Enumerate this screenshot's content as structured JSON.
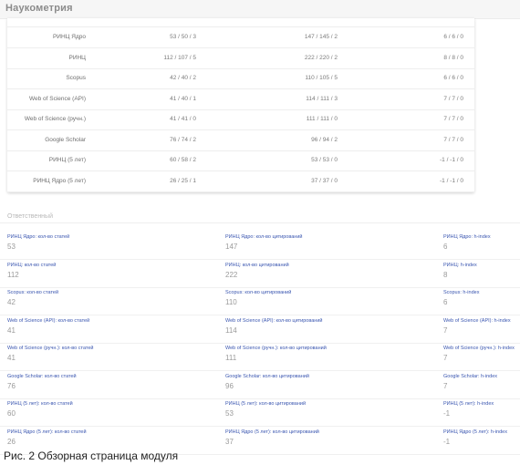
{
  "header": {
    "title": "Наукометрия"
  },
  "summary_table": {
    "rows": [
      {
        "metric": "РИНЦ Ядро",
        "articles": "53 / 50 / 3",
        "citations": "147 / 145 / 2",
        "hindex": "6 / 6 / 0"
      },
      {
        "metric": "РИНЦ",
        "articles": "112 / 107 / 5",
        "citations": "222 / 220 / 2",
        "hindex": "8 / 8 / 0"
      },
      {
        "metric": "Scopus",
        "articles": "42 / 40 / 2",
        "citations": "110 / 105 / 5",
        "hindex": "6 / 6 / 0"
      },
      {
        "metric": "Web of Science (API)",
        "articles": "41 / 40 / 1",
        "citations": "114 / 111 / 3",
        "hindex": "7 / 7 / 0"
      },
      {
        "metric": "Web of Science (ручн.)",
        "articles": "41 / 41 / 0",
        "citations": "111 / 111 / 0",
        "hindex": "7 / 7 / 0"
      },
      {
        "metric": "Google Scholar",
        "articles": "76 / 74 / 2",
        "citations": "96 / 94 / 2",
        "hindex": "7 / 7 / 0"
      },
      {
        "metric": "РИНЦ (5 лет)",
        "articles": "60 / 58 / 2",
        "citations": "53 / 53 / 0",
        "hindex": "-1 / -1 / 0"
      },
      {
        "metric": "РИНЦ Ядро (5 лет)",
        "articles": "26 / 25 / 1",
        "citations": "37 / 37 / 0",
        "hindex": "-1 / -1 / 0"
      }
    ]
  },
  "responsible": {
    "label": "Ответственный",
    "rows": [
      [
        {
          "label": "РИНЦ Ядро: кол-во статей",
          "value": "53"
        },
        {
          "label": "РИНЦ Ядро: кол-во цитирований",
          "value": "147"
        },
        {
          "label": "РИНЦ Ядро: h-index",
          "value": "6"
        }
      ],
      [
        {
          "label": "РИНЦ: кол-во статей",
          "value": "112"
        },
        {
          "label": "РИНЦ: кол-во цитирований",
          "value": "222"
        },
        {
          "label": "РИНЦ: h-index",
          "value": "8"
        }
      ],
      [
        {
          "label": "Scopus: кол-во статей",
          "value": "42"
        },
        {
          "label": "Scopus: кол-во цитирований",
          "value": "110"
        },
        {
          "label": "Scopus: h-index",
          "value": "6"
        }
      ],
      [
        {
          "label": "Web of Science (API): кол-во статей",
          "value": "41"
        },
        {
          "label": "Web of Science (API): кол-во цитирований",
          "value": "114"
        },
        {
          "label": "Web of Science (API): h-index",
          "value": "7"
        }
      ],
      [
        {
          "label": "Web of Science (ручн.): кол-во статей",
          "value": "41"
        },
        {
          "label": "Web of Science (ручн.): кол-во цитирований",
          "value": "111"
        },
        {
          "label": "Web of Science (ручн.): h-index",
          "value": "7"
        }
      ],
      [
        {
          "label": "Google Scholar: кол-во статей",
          "value": "76"
        },
        {
          "label": "Google Scholar: кол-во цитирований",
          "value": "96"
        },
        {
          "label": "Google Scholar: h-index",
          "value": "7"
        }
      ],
      [
        {
          "label": "РИНЦ (5 лет): кол-во статей",
          "value": "60"
        },
        {
          "label": "РИНЦ (5 лет): кол-во цитирований",
          "value": "53"
        },
        {
          "label": "РИНЦ (5 лет): h-index",
          "value": "-1"
        }
      ],
      [
        {
          "label": "РИНЦ Ядро (5 лет): кол-во статей",
          "value": "26"
        },
        {
          "label": "РИНЦ Ядро (5 лет): кол-во цитирований",
          "value": "37"
        },
        {
          "label": "РИНЦ Ядро (5 лет): h-index",
          "value": "-1"
        }
      ]
    ]
  },
  "caption": "Рис. 2 Обзорная страница модуля",
  "colors": {
    "label_blue": "#3a56b0",
    "value_gray": "#9a9a9a"
  }
}
